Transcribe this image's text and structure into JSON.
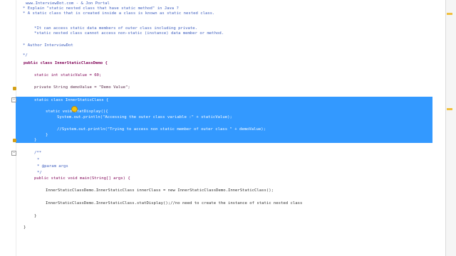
{
  "editor": {
    "lines": {
      "l0": "www.InterviewDot.com - & Jon Portal",
      "l1": "* Explain \"static nested class that have static method\" in Java ?",
      "l2": "* A static class that is created inside a class is known as static nested class.",
      "l3": "*It can access static data members of outer class including private.",
      "l4": "*static nested class cannot access non-static (instance) data member or method.",
      "l5": "* Author InterviewDot",
      "l6": "*/",
      "l7": "public class InnerStaticClassDemo {",
      "l8": "static int staticValue = 60;",
      "l9": "private String demoValue = \"Demo Value\";",
      "l10": "static class InnerStaticClass {",
      "l11": "static void statDisplay(){",
      "l12": "System.out.println(\"Accessing the outer class variable :\" + staticValue);",
      "l13": "//System.out.println(\"Trying to access non static member of outer class \" + demoValue);",
      "l14": "}",
      "l15": "}",
      "l16": "/**",
      "l17": "*",
      "l18": "* @param args",
      "l19": "*/",
      "l20": "public static void main(String[] args) {",
      "l21": "InnerStaticClassDemo.InnerStaticClass innerClass = new InnerStaticClassDemo.InnerStaticClass();",
      "l22": "InnerStaticClassDemo.InnerStaticClass.statDisplay();//no need to create the instance of static nested class",
      "l23": "}",
      "l24": "}"
    }
  },
  "colors": {
    "selection": "#3399ff",
    "keyword": "#7f0055",
    "comment": "#3f5fbf",
    "string": "#2a00ff"
  },
  "icons": {
    "marker": "lightbulb-icon",
    "annotation": "override-marker-icon"
  }
}
